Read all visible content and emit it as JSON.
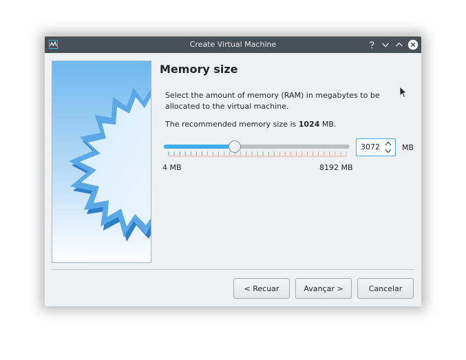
{
  "window": {
    "title": "Create Virtual Machine",
    "buttons": [
      "help-icon",
      "minimize-icon",
      "maximize-icon",
      "close-icon"
    ]
  },
  "page": {
    "heading": "Memory size",
    "description": "Select the amount of memory (RAM) in megabytes to be allocated to the virtual machine.",
    "recommend_prefix": "The recommended memory size is ",
    "recommend_value": "1024",
    "recommend_suffix": " MB."
  },
  "memory": {
    "min_label": "4 MB",
    "max_label": "8192 MB",
    "min": 4,
    "max": 8192,
    "value": 3072,
    "value_text": "3072",
    "unit": "MB"
  },
  "buttons": {
    "back": "< Recuar",
    "next": "Avançar >",
    "cancel": "Cancelar"
  },
  "colors": {
    "accent": "#3daee9",
    "titlebar": "#475057",
    "tick_green": "#7ec87e",
    "tick_red": "#e8a89a"
  }
}
